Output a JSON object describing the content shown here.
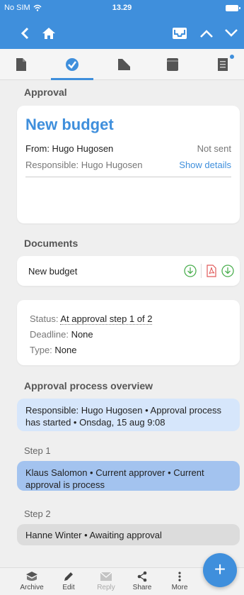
{
  "status_bar": {
    "carrier": "No SIM",
    "time": "13.29"
  },
  "nav": {
    "back_icon": "chevron-left-icon",
    "home_icon": "home-icon",
    "inbox_icon": "inbox-icon",
    "up_icon": "chevron-up-icon",
    "down_icon": "chevron-down-icon"
  },
  "tabs": [
    {
      "icon": "document-icon",
      "active": false
    },
    {
      "icon": "check-circle-icon",
      "active": true
    },
    {
      "icon": "folder-icon",
      "active": false
    },
    {
      "icon": "archive-box-icon",
      "active": false
    },
    {
      "icon": "notes-icon",
      "active": false,
      "badge": true
    }
  ],
  "approval": {
    "section_title": "Approval",
    "title": "New budget",
    "from": "From: Hugo Hugosen",
    "sent_status": "Not sent",
    "responsible": "Responsible: Hugo Hugosen",
    "show_details": "Show details"
  },
  "documents": {
    "section_title": "Documents",
    "items": [
      {
        "name": "New budget"
      }
    ]
  },
  "status_card": {
    "status_label": "Status:",
    "status_value": "At approval step 1 of 2",
    "deadline_label": "Deadline:",
    "deadline_value": "None",
    "type_label": "Type:",
    "type_value": "None"
  },
  "overview": {
    "section_title": "Approval process overview",
    "summary": "Responsible: Hugo Hugosen • Approval process has started • Onsdag, 15 aug 9:08",
    "steps": [
      {
        "label": "Step 1",
        "text": "Klaus Salomon • Current approver • Current approval is process"
      },
      {
        "label": "Step 2",
        "text": "Hanne Winter • Awaiting approval"
      }
    ]
  },
  "bottom_bar": {
    "items": [
      {
        "label": "Archive",
        "enabled": true
      },
      {
        "label": "Edit",
        "enabled": true
      },
      {
        "label": "Reply",
        "enabled": false
      },
      {
        "label": "Share",
        "enabled": true
      },
      {
        "label": "More",
        "enabled": true
      }
    ],
    "fab_label": "+"
  },
  "colors": {
    "accent": "#3f8fdc",
    "summary_bg": "#d6e6fb",
    "current_step_bg": "#a3c3ef",
    "pending_step_bg": "#dcdcdc",
    "download_green": "#4caf50",
    "pdf_red": "#e05a5a"
  }
}
